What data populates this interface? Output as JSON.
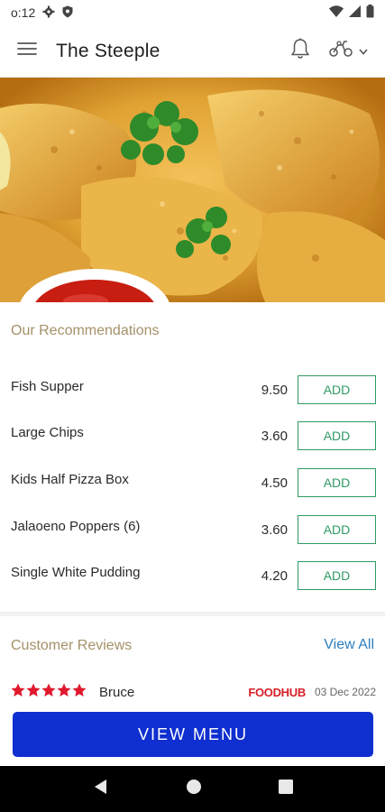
{
  "status_bar": {
    "time": "o:12"
  },
  "app_bar": {
    "title": "The Steeple"
  },
  "hero": {
    "icon": "fried-fish-photo"
  },
  "recommendations": {
    "title": "Our Recommendations",
    "items": [
      {
        "name": "Fish Supper",
        "price": "9.50",
        "button": "ADD"
      },
      {
        "name": "Large Chips",
        "price": "3.60",
        "button": "ADD"
      },
      {
        "name": "Kids Half Pizza Box",
        "price": "4.50",
        "button": "ADD"
      },
      {
        "name": "Jalaoeno Poppers (6)",
        "price": "3.60",
        "button": "ADD"
      },
      {
        "name": "Single White Pudding",
        "price": "4.20",
        "button": "ADD"
      }
    ]
  },
  "reviews": {
    "title": "Customer Reviews",
    "view_all": "View All",
    "first": {
      "rating": 5,
      "reviewer": "Bruce",
      "source": "FOODHUB",
      "date": "03 Dec 2022"
    }
  },
  "cta": {
    "label": "VIEW MENU"
  },
  "colors": {
    "accent_button": "#0f2fd0",
    "add_green": "#2f9a63",
    "section_gold": "#a49169",
    "star_red": "#e0182d",
    "link_blue": "#2c7fbf"
  }
}
